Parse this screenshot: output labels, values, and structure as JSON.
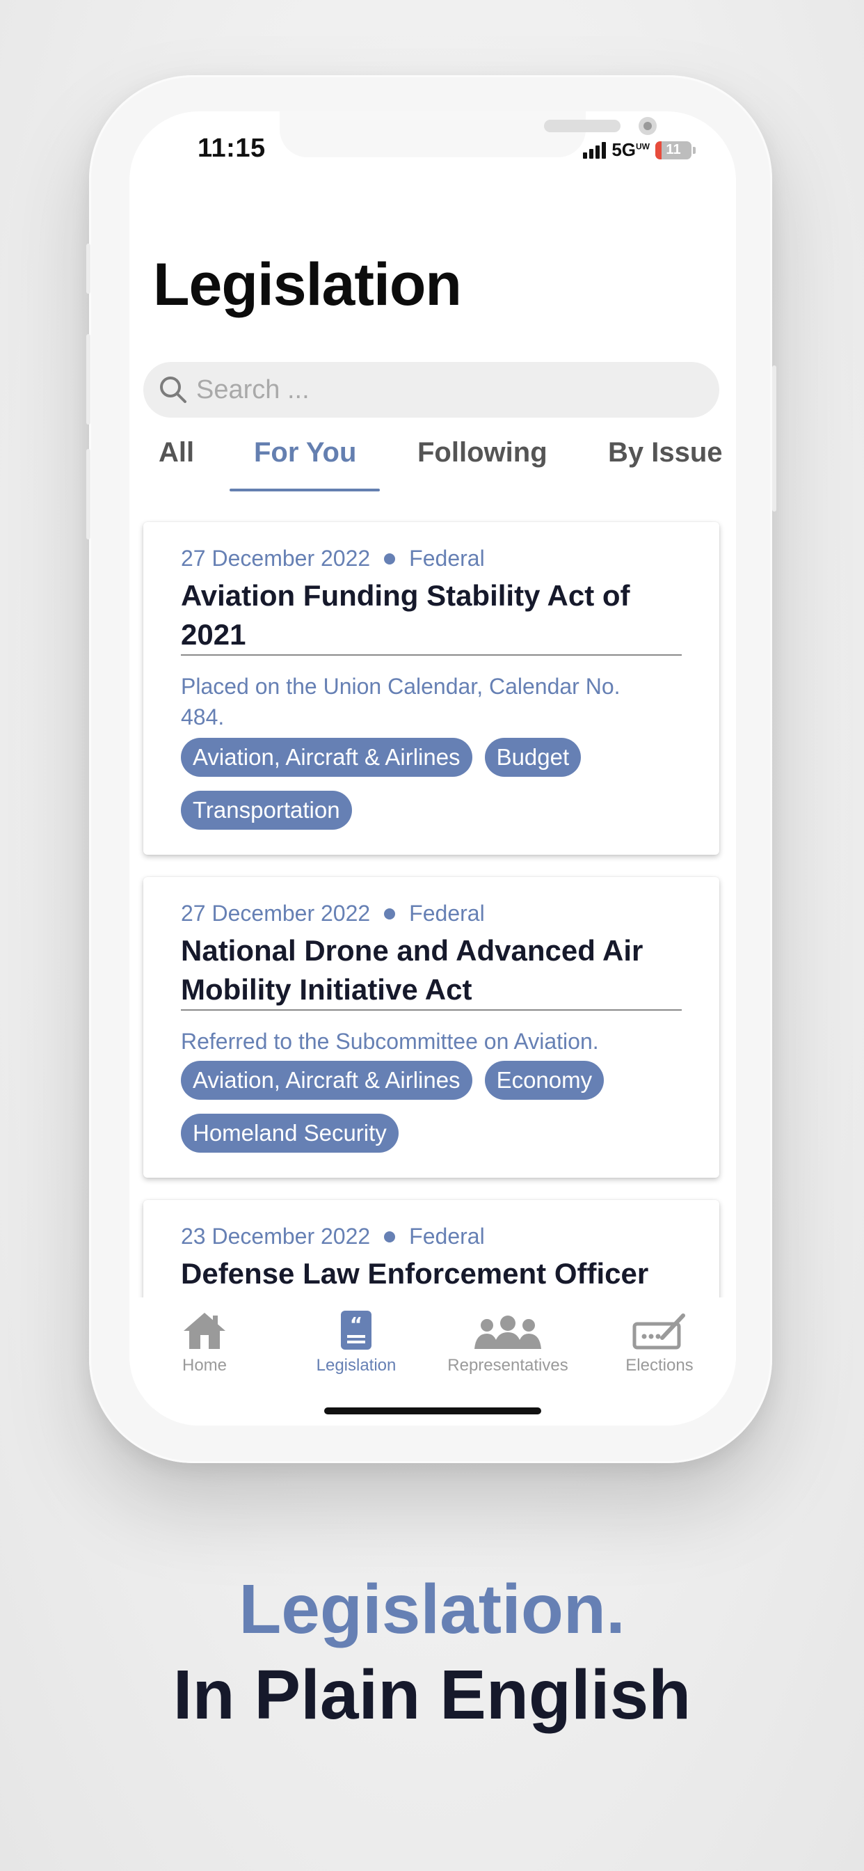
{
  "status_bar": {
    "time": "11:15",
    "network": "5G",
    "network_sup": "UW",
    "battery": "11"
  },
  "page": {
    "title": "Legislation"
  },
  "search": {
    "placeholder": "Search ..."
  },
  "tabs": [
    {
      "label": "All"
    },
    {
      "label": "For You",
      "active": true
    },
    {
      "label": "Following"
    },
    {
      "label": "By Issue"
    }
  ],
  "cards": [
    {
      "date": "27 December 2022",
      "level": "Federal",
      "title": "Aviation Funding Stability Act of 2021",
      "status": "Placed on the Union Calendar, Calendar No. 484.",
      "tags": [
        "Aviation, Aircraft & Airlines",
        "Budget",
        "Transportation"
      ]
    },
    {
      "date": "27 December 2022",
      "level": "Federal",
      "title": "National Drone and Advanced Air Mobility Initiative Act",
      "status": "Referred to the Subcommittee on Aviation.",
      "tags": [
        "Aviation, Aircraft & Airlines",
        "Economy",
        "Homeland Security"
      ]
    },
    {
      "date": "23 December 2022",
      "level": "Federal",
      "title": "Defense Law Enforcement Officer"
    }
  ],
  "tabbar": [
    {
      "label": "Home",
      "icon": "home-icon"
    },
    {
      "label": "Legislation",
      "icon": "quote-document-icon",
      "active": true
    },
    {
      "label": "Representatives",
      "icon": "people-icon"
    },
    {
      "label": "Elections",
      "icon": "ballot-icon"
    }
  ],
  "marketing": {
    "line1": "Legislation.",
    "line2": "In Plain English"
  },
  "colors": {
    "accent": "#6680b4",
    "dark": "#16192b",
    "tab_inactive": "#9a9a9a"
  }
}
